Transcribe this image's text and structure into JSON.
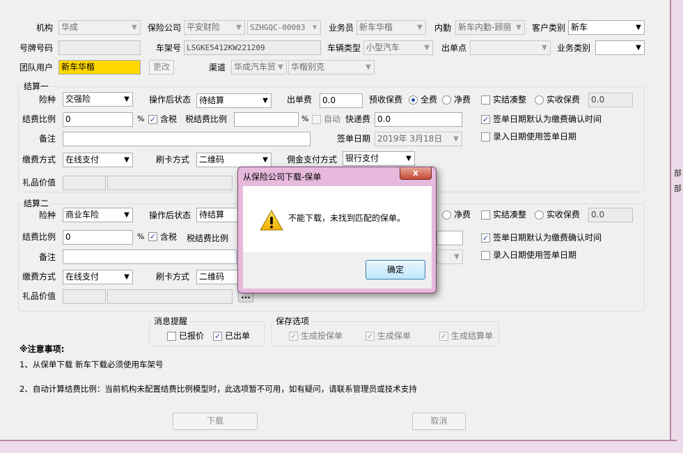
{
  "row1": {
    "org_label": "机构",
    "org_value": "华成",
    "insurer_label": "保险公司",
    "insurer_value": "平安财险",
    "insurer_code": "SZHGQC-00003",
    "salesman_label": "业务员",
    "salesman_value": "新车华楷",
    "internal_label": "内勤",
    "internal_value": "新车内勤-顾丽",
    "customer_type_label": "客户类别",
    "customer_type_value": "新车"
  },
  "row2": {
    "plate_label": "号牌号码",
    "plate_value": "",
    "vin_label": "车架号",
    "vin_value": "LSGKE5412KW221209",
    "vehicle_type_label": "车辆类型",
    "vehicle_type_value": "小型汽车",
    "issue_point_label": "出单点",
    "issue_point_value": "",
    "biz_type_label": "业务类别",
    "biz_type_value": ""
  },
  "row3": {
    "team_label": "团队用户",
    "team_value": "新车华楷",
    "change_btn": "更改",
    "channel_label": "渠道",
    "channel_value": "华成汽车贸",
    "channel_sub_value": "华楷别克"
  },
  "settle1": {
    "title": "结算一",
    "ins_type_label": "险种",
    "ins_type_value": "交强险",
    "post_status_label": "操作后状态",
    "post_status_value": "待结算",
    "issue_fee_label": "出单费",
    "issue_fee_value": "0.0",
    "pre_premium_label": "预收保费",
    "full_label": "全费",
    "net_label": "净费",
    "actual_label": "实结凑整",
    "actual_premium_label": "实收保费",
    "actual_premium_value": "0.0",
    "rate_label": "结费比例",
    "rate_value": "0",
    "pct": "%",
    "tax_label": "含税",
    "tax_rate_label": "税结费比例",
    "tax_rate_value": "",
    "auto_label": "自动",
    "express_label": "快递费",
    "express_value": "0.0",
    "sign_confirm_label": "签单日期默认为缴费确认时间",
    "remark_label": "备注",
    "remark_value": "",
    "sign_date_label": "签单日期",
    "sign_date_value": "2019年 3月18日",
    "entry_date_label": "录入日期使用签单日期",
    "pay_method_label": "缴费方式",
    "pay_method_value": "在线支付",
    "card_label": "刷卡方式",
    "card_value": "二维码",
    "commission_label": "佣金支付方式",
    "commission_value": "银行支付",
    "gift_label": "礼品价值"
  },
  "settle2": {
    "title": "结算二",
    "ins_type_label": "险种",
    "ins_type_value": "商业车险",
    "post_status_label": "操作后状态",
    "post_status_value": "待结算",
    "net_label": "净费",
    "actual_label": "实结凑整",
    "actual_premium_label": "实收保费",
    "actual_premium_value": "0.0",
    "rate_label": "结费比例",
    "rate_value": "0",
    "pct": "%",
    "tax_label": "含税",
    "tax_rate_label": "税结费比例",
    "sign_confirm_label": "签单日期默认为缴费确认时间",
    "remark_label": "备注",
    "entry_date_label": "录入日期使用签单日期",
    "pay_method_label": "缴费方式",
    "pay_method_value": "在线支付",
    "card_label": "刷卡方式",
    "card_value": "二维码",
    "gift_label": "礼品价值",
    "gift_btn": "..."
  },
  "notify": {
    "title": "消息提醒",
    "reported": "已报价",
    "issued": "已出单"
  },
  "save": {
    "title": "保存选项",
    "gen_proposal": "生成投保单",
    "gen_policy": "生成保单",
    "gen_settlement": "生成结算单"
  },
  "notes": {
    "title": "※注意事项:",
    "line1": "1、从保单下载 新车下载必须使用车架号",
    "line2": "2、自动计算结费比例：当前机构未配置结费比例模型时，此选项暂不可用，如有疑问，请联系管理员或技术支持"
  },
  "buttons": {
    "download": "下载",
    "cancel": "取消"
  },
  "dialog": {
    "title": "从保险公司下载-保单",
    "message": "不能下载，未找到匹配的保单。",
    "ok": "确定",
    "close": "x"
  },
  "bg_window": {
    "frag1": "部",
    "frag2": "部"
  },
  "colors": {
    "team_highlight": "#ffd800",
    "dialog_frame": "#e6b9dd",
    "close_button": "#c54a36"
  }
}
